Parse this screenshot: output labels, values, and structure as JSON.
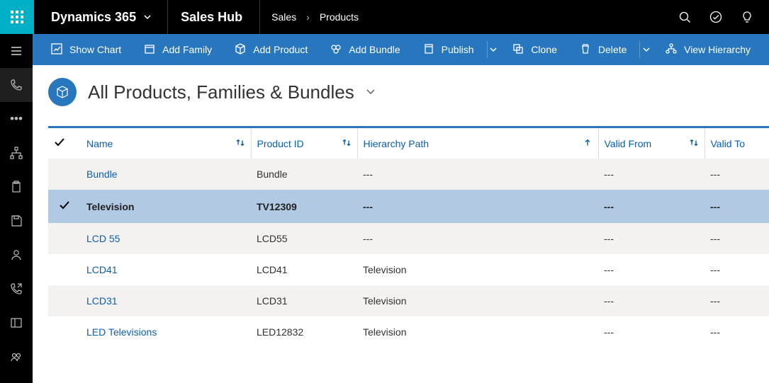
{
  "header": {
    "brand": "Dynamics 365",
    "app_name": "Sales Hub",
    "breadcrumbs": [
      "Sales",
      "Products"
    ]
  },
  "commands": {
    "show_chart": "Show Chart",
    "add_family": "Add Family",
    "add_product": "Add Product",
    "add_bundle": "Add Bundle",
    "publish": "Publish",
    "clone": "Clone",
    "delete": "Delete",
    "view_hierarchy": "View Hierarchy"
  },
  "view": {
    "title": "All Products, Families & Bundles"
  },
  "columns": {
    "name": "Name",
    "product_id": "Product ID",
    "hierarchy_path": "Hierarchy Path",
    "valid_from": "Valid From",
    "valid_to": "Valid To"
  },
  "rows": [
    {
      "name": "Bundle",
      "product_id": "Bundle",
      "hierarchy_path": "---",
      "valid_from": "---",
      "valid_to": "---",
      "selected": false
    },
    {
      "name": "Television",
      "product_id": "TV12309",
      "hierarchy_path": "---",
      "valid_from": "---",
      "valid_to": "---",
      "selected": true
    },
    {
      "name": "LCD 55",
      "product_id": "LCD55",
      "hierarchy_path": "---",
      "valid_from": "---",
      "valid_to": "---",
      "selected": false
    },
    {
      "name": "LCD41",
      "product_id": "LCD41",
      "hierarchy_path": "Television",
      "valid_from": "---",
      "valid_to": "---",
      "selected": false
    },
    {
      "name": "LCD31",
      "product_id": "LCD31",
      "hierarchy_path": "Television",
      "valid_from": "---",
      "valid_to": "---",
      "selected": false
    },
    {
      "name": "LED Televisions",
      "product_id": "LED12832",
      "hierarchy_path": "Television",
      "valid_from": "---",
      "valid_to": "---",
      "selected": false
    }
  ]
}
